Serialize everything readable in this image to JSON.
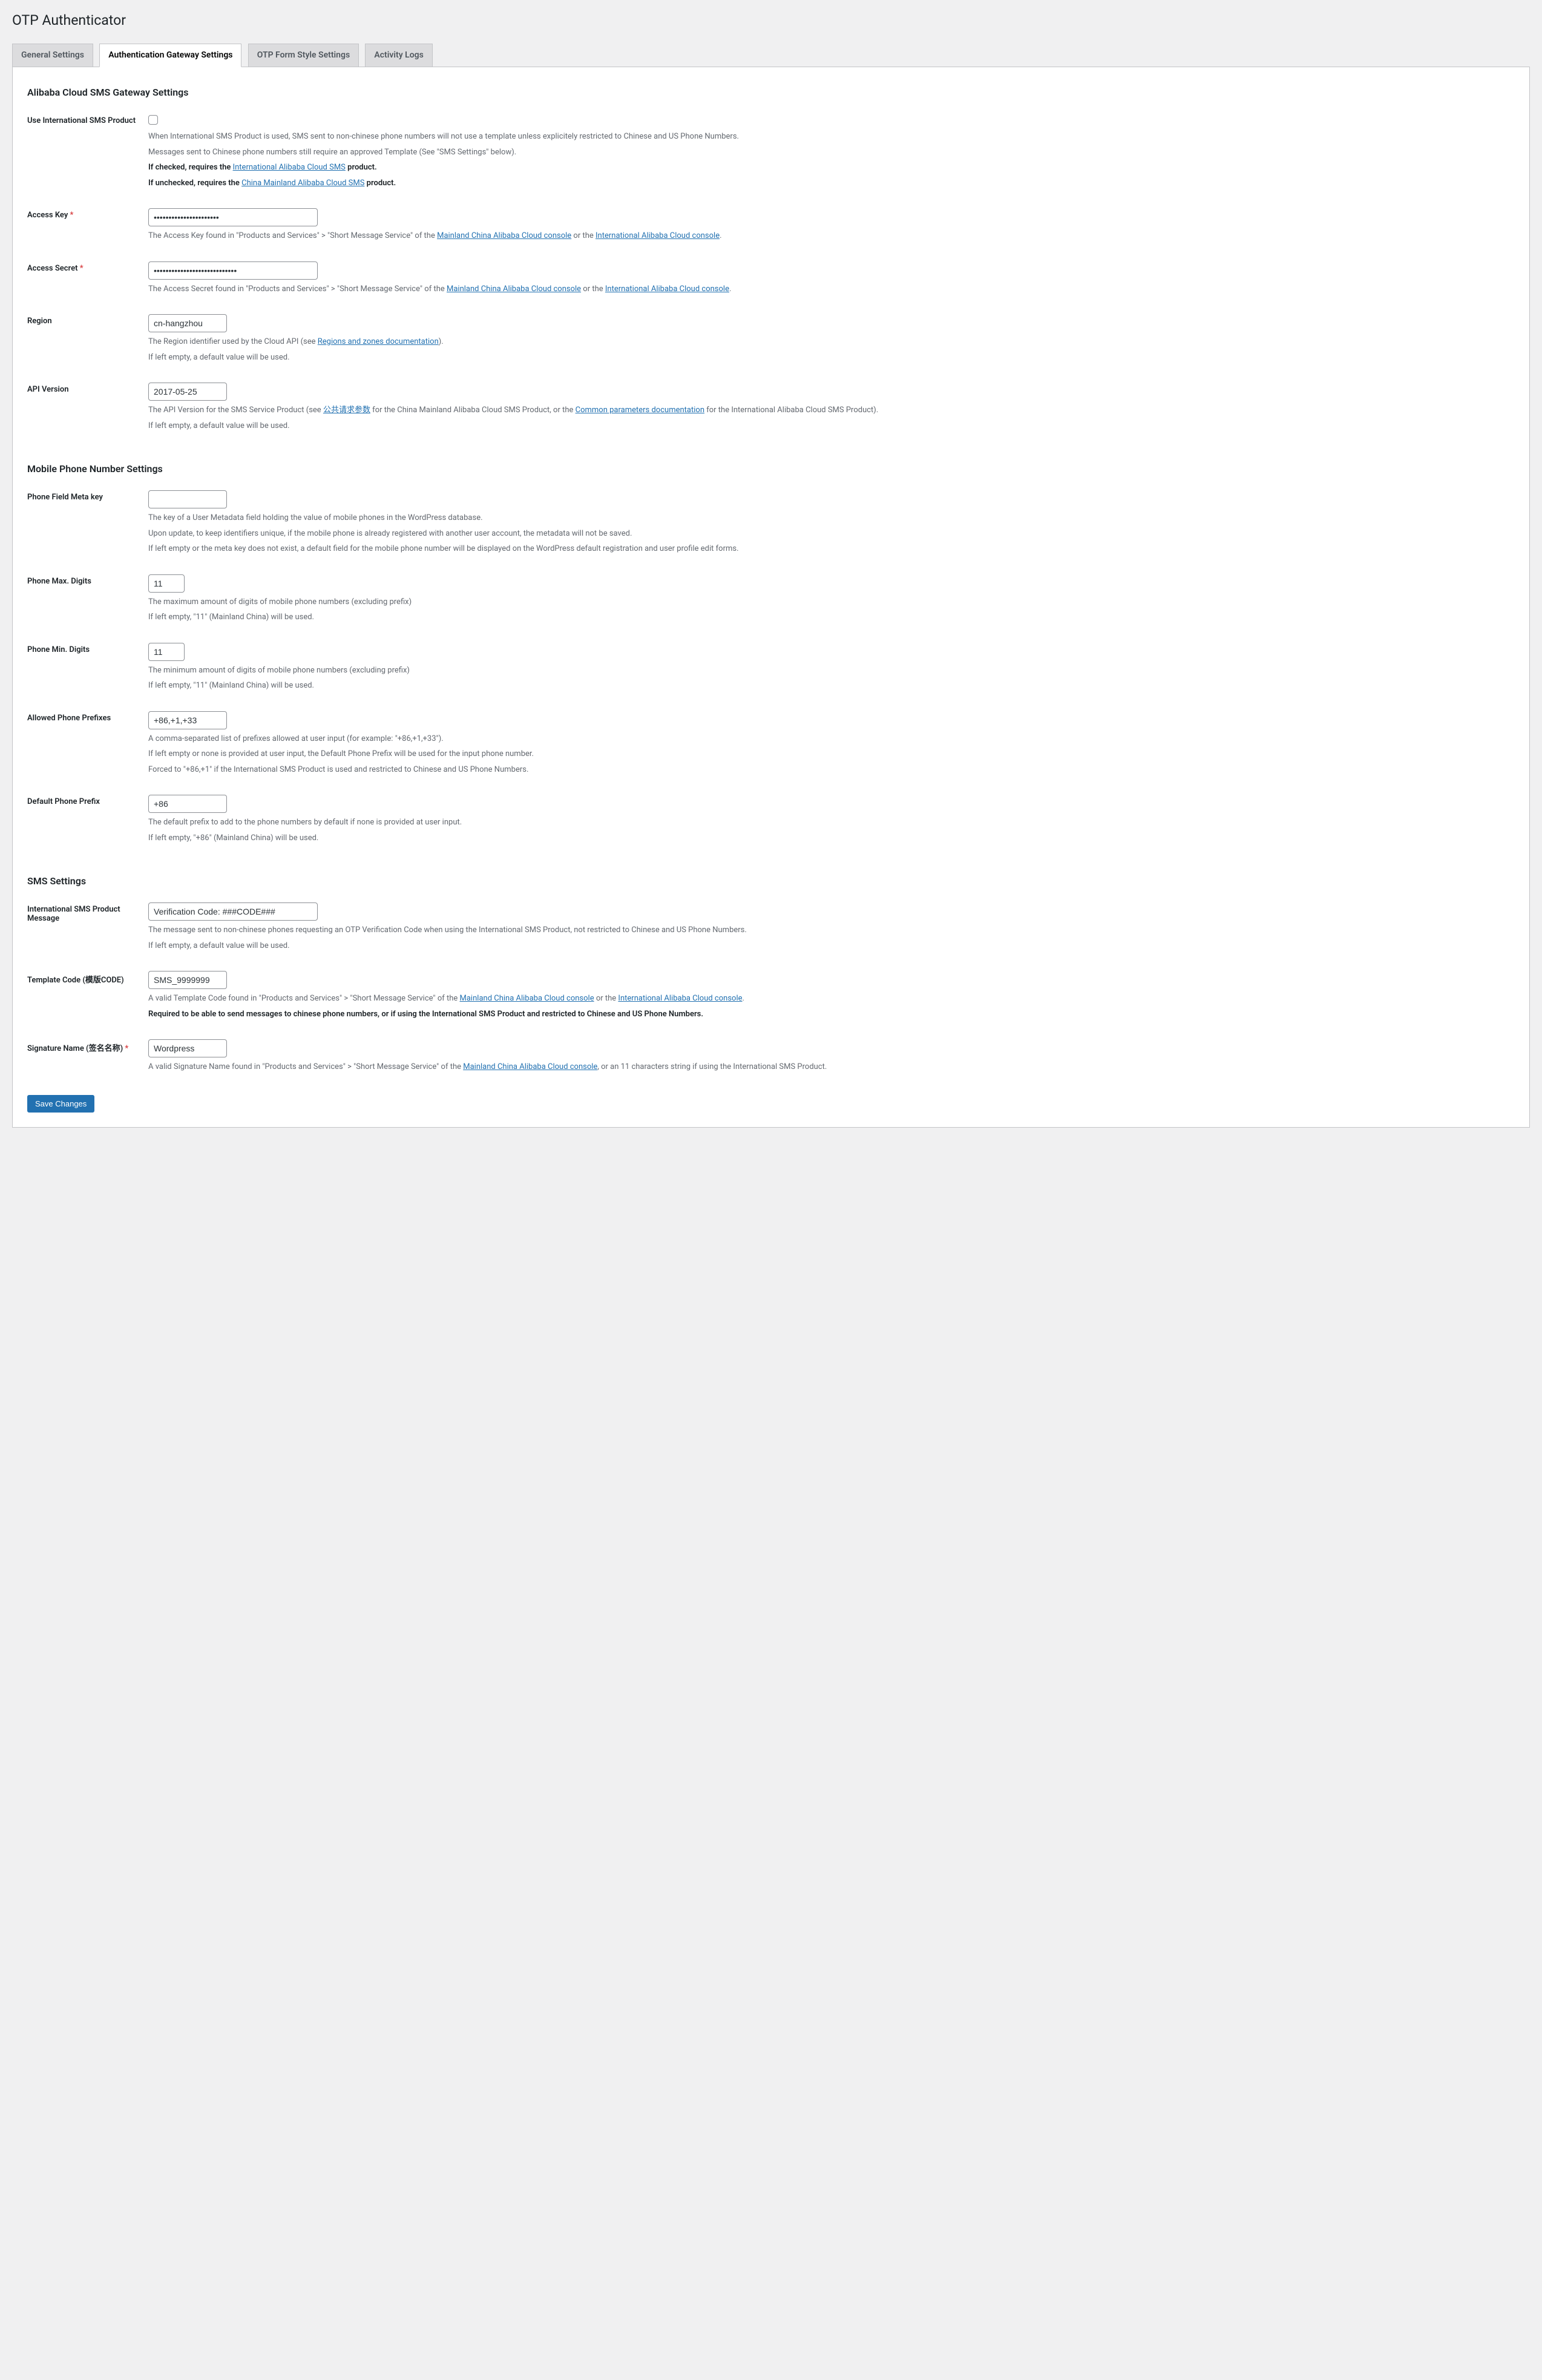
{
  "page_title": "OTP Authenticator",
  "tabs": {
    "general": "General Settings",
    "auth": "Authentication Gateway Settings",
    "form": "OTP Form Style Settings",
    "logs": "Activity Logs"
  },
  "sections": {
    "alibaba": "Alibaba Cloud SMS Gateway Settings",
    "phone": "Mobile Phone Number Settings",
    "sms": "SMS Settings"
  },
  "fields": {
    "use_intl": {
      "label": "Use International SMS Product",
      "d1": "When International SMS Product is used, SMS sent to non-chinese phone numbers will not use a template unless explicitely restricted to Chinese and US Phone Numbers.",
      "d2": "Messages sent to Chinese phone numbers still require an approved Template (See \"SMS Settings\" below).",
      "d3a": "If checked, requires the ",
      "d3link": "International Alibaba Cloud SMS",
      "d3b": " product.",
      "d4a": "If unchecked, requires the ",
      "d4link": "China Mainland Alibaba Cloud SMS",
      "d4b": " product."
    },
    "access_key": {
      "label": "Access Key",
      "value": "••••••••••••••••••••••",
      "d_a": "The Access Key found in \"Products and Services\" > \"Short Message Service\" of the ",
      "link1": "Mainland China Alibaba Cloud console",
      "d_b": " or the ",
      "link2": "International Alibaba Cloud console",
      "d_c": "."
    },
    "access_secret": {
      "label": "Access Secret",
      "value": "••••••••••••••••••••••••••••",
      "d_a": "The Access Secret found in \"Products and Services\" > \"Short Message Service\" of the ",
      "link1": "Mainland China Alibaba Cloud console",
      "d_b": " or the ",
      "link2": "International Alibaba Cloud console",
      "d_c": "."
    },
    "region": {
      "label": "Region",
      "value": "cn-hangzhou",
      "d_a": "The Region identifier used by the Cloud API (see ",
      "link": "Regions and zones documentation",
      "d_b": ").",
      "d2": "If left empty, a default value will be used."
    },
    "api_version": {
      "label": "API Version",
      "value": "2017-05-25",
      "d_a": "The API Version for the SMS Service Product (see ",
      "link1": "公共请求参数",
      "d_b": " for the China Mainland Alibaba Cloud SMS Product, or the ",
      "link2": "Common parameters documentation",
      "d_c": " for the International Alibaba Cloud SMS Product).",
      "d2": "If left empty, a default value will be used."
    },
    "phone_meta": {
      "label": "Phone Field Meta key",
      "value": "",
      "d1": "The key of a User Metadata field holding the value of mobile phones in the WordPress database.",
      "d2": "Upon update, to keep identifiers unique, if the mobile phone is already registered with another user account, the metadata will not be saved.",
      "d3": "If left empty or the meta key does not exist, a default field for the mobile phone number will be displayed on the WordPress default registration and user profile edit forms."
    },
    "phone_max": {
      "label": "Phone Max. Digits",
      "value": "11",
      "d1": "The maximum amount of digits of mobile phone numbers (excluding prefix)",
      "d2": "If left empty, \"11\" (Mainland China) will be used."
    },
    "phone_min": {
      "label": "Phone Min. Digits",
      "value": "11",
      "d1": "The minimum amount of digits of mobile phone numbers (excluding prefix)",
      "d2": "If left empty, \"11\" (Mainland China) will be used."
    },
    "allowed_prefixes": {
      "label": "Allowed Phone Prefixes",
      "value": "+86,+1,+33",
      "d1": "A comma-separated list of prefixes allowed at user input (for example: \"+86,+1,+33\").",
      "d2": "If left empty or none is provided at user input, the Default Phone Prefix will be used for the input phone number.",
      "d3": "Forced to \"+86,+1\" if the International SMS Product is used and restricted to Chinese and US Phone Numbers."
    },
    "default_prefix": {
      "label": "Default Phone Prefix",
      "value": "+86",
      "d1": "The default prefix to add to the phone numbers by default if none is provided at user input.",
      "d2": "If left empty, \"+86\" (Mainland China) will be used."
    },
    "intl_message": {
      "label": "International SMS Product Message",
      "value": "Verification Code: ###CODE###",
      "d1": "The message sent to non-chinese phones requesting an OTP Verification Code when using the International SMS Product, not restricted to Chinese and US Phone Numbers.",
      "d2": "If left empty, a default value will be used."
    },
    "template_code": {
      "label": "Template Code (模版CODE)",
      "value": "SMS_9999999",
      "d_a": "A valid Template Code found in \"Products and Services\" > \"Short Message Service\" of the ",
      "link1": "Mainland China Alibaba Cloud console",
      "d_b": " or the ",
      "link2": "International Alibaba Cloud console",
      "d_c": ".",
      "d2": "Required to be able to send messages to chinese phone numbers, or if using the International SMS Product and restricted to Chinese and US Phone Numbers."
    },
    "signature": {
      "label": "Signature Name (签名名称)",
      "value": "Wordpress",
      "d_a": "A valid Signature Name found in \"Products and Services\" > \"Short Message Service\" of the ",
      "link": "Mainland China Alibaba Cloud console",
      "d_b": ", or an 11 characters string if using the International SMS Product."
    }
  },
  "save_button": "Save Changes"
}
